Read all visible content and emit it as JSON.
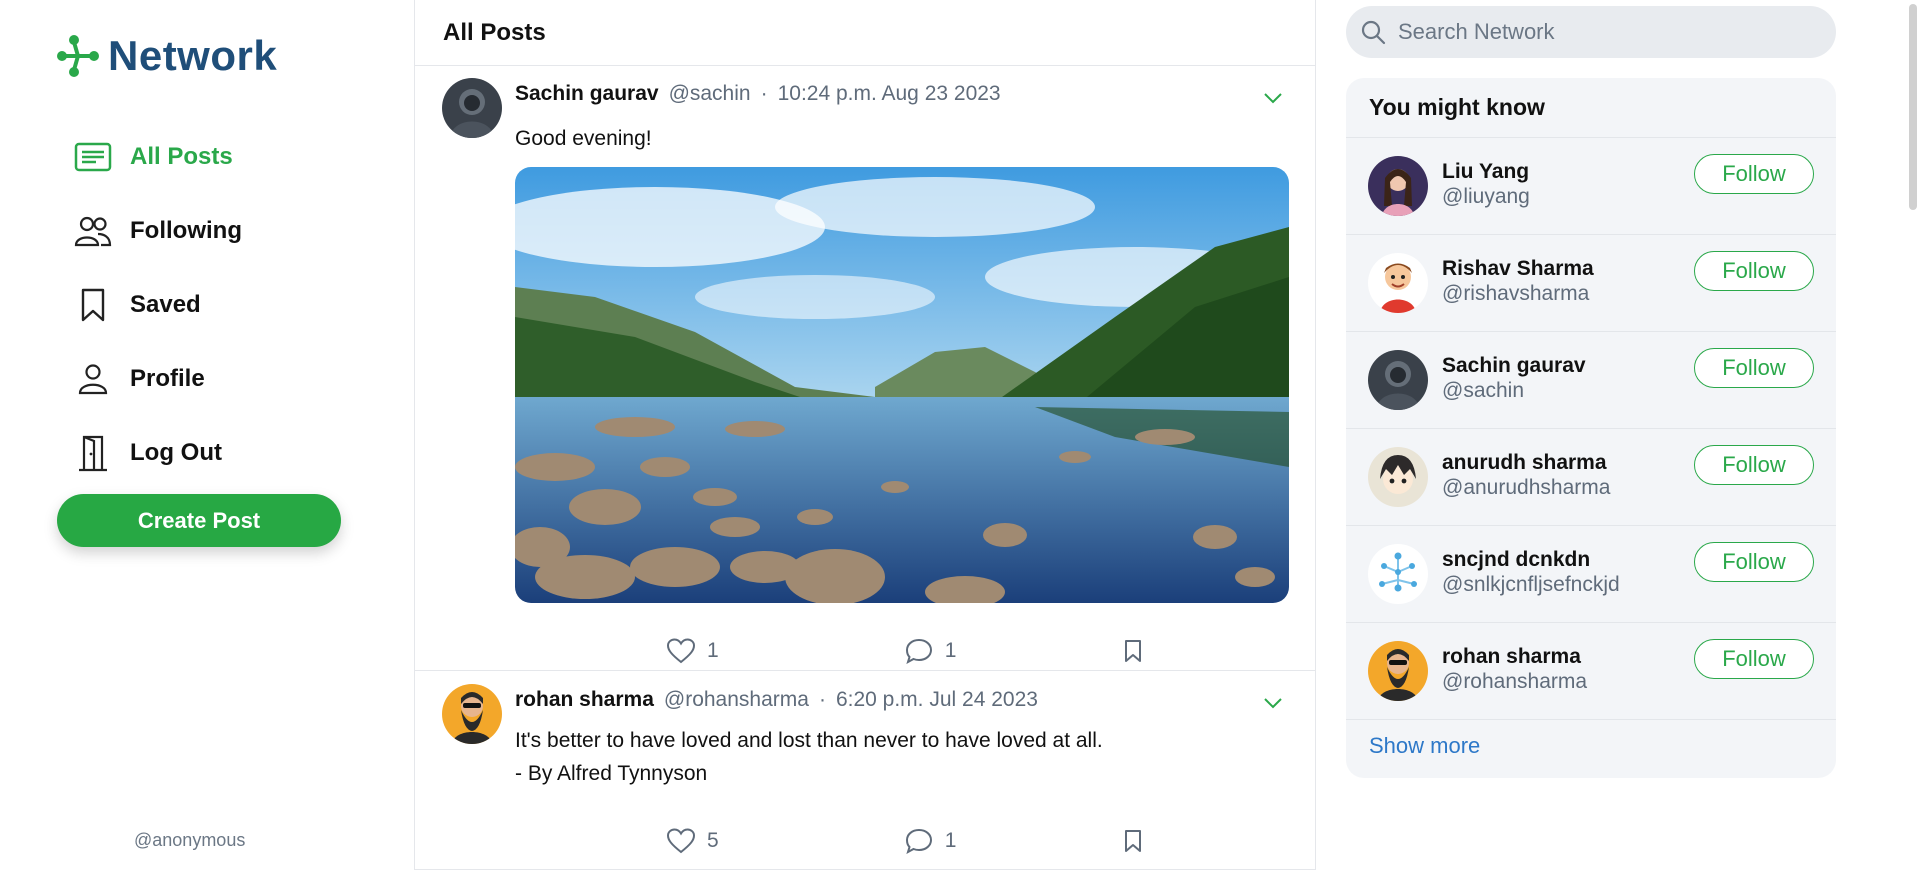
{
  "brand": {
    "name": "Network",
    "accent": "#2aa84a",
    "logo_color": "#1f4e79"
  },
  "sidebar": {
    "items": [
      {
        "label": "All Posts",
        "icon": "list-icon",
        "active": true
      },
      {
        "label": "Following",
        "icon": "people-icon",
        "active": false
      },
      {
        "label": "Saved",
        "icon": "bookmark-icon",
        "active": false
      },
      {
        "label": "Profile",
        "icon": "person-icon",
        "active": false
      },
      {
        "label": "Log Out",
        "icon": "door-icon",
        "active": false
      }
    ],
    "create_label": "Create Post",
    "current_user": "@anonymous"
  },
  "feed": {
    "title": "All Posts",
    "posts": [
      {
        "name": "Sachin gaurav",
        "handle": "@sachin",
        "sep": "·",
        "time": "10:24 p.m. Aug 23 2023",
        "text": "Good evening!",
        "likes": "1",
        "comments": "1"
      },
      {
        "name": "rohan sharma",
        "handle": "@rohansharma",
        "sep": "·",
        "time": "6:20 p.m. Jul 24 2023",
        "text_line1": "It's better to have loved and lost than never to have loved at all.",
        "text_line2": "- By Alfred Tynnyson",
        "likes": "5",
        "comments": "1"
      }
    ]
  },
  "search": {
    "placeholder": "Search Network"
  },
  "suggestions": {
    "title": "You might know",
    "follow_label": "Follow",
    "people": [
      {
        "name": "Liu Yang",
        "handle": "@liuyang"
      },
      {
        "name": "Rishav Sharma",
        "handle": "@rishavsharma"
      },
      {
        "name": "Sachin gaurav",
        "handle": "@sachin"
      },
      {
        "name": "anurudh sharma",
        "handle": "@anurudhsharma"
      },
      {
        "name": "sncjnd dcnkdn",
        "handle": "@snlkjcnfljsefnckjd"
      },
      {
        "name": "rohan sharma",
        "handle": "@rohansharma"
      }
    ],
    "show_more": "Show more"
  }
}
